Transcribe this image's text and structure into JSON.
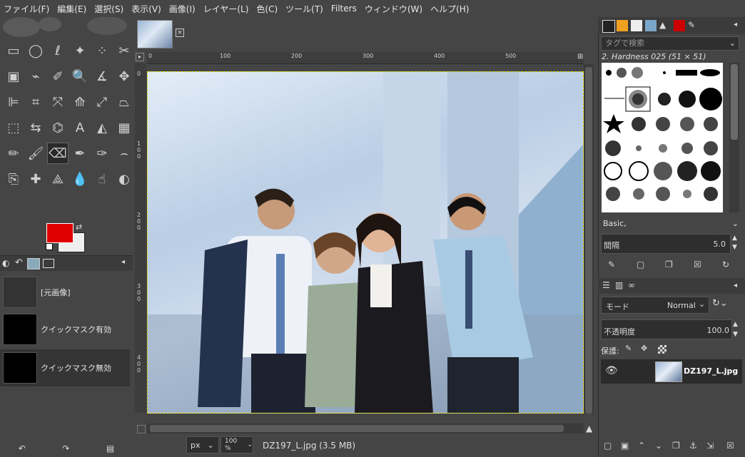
{
  "menubar": {
    "items": [
      "ファイル(F)",
      "編集(E)",
      "選択(S)",
      "表示(V)",
      "画像(I)",
      "レイヤー(L)",
      "色(C)",
      "ツール(T)",
      "Filters",
      "ウィンドウ(W)",
      "ヘルプ(H)"
    ]
  },
  "toolbox": {
    "tools": [
      "rect-select",
      "ellipse-select",
      "free-select",
      "fuzzy-select",
      "select-by-color",
      "scissors",
      "foreground-select",
      "paths",
      "color-picker",
      "zoom",
      "measure",
      "move",
      "align",
      "crop",
      "unified-transform",
      "warp-transform",
      "handle-transform",
      "perspective",
      "3d-transform",
      "flip",
      "cage-transform",
      "text",
      "bucket-fill",
      "gradient",
      "pencil",
      "paintbrush",
      "eraser",
      "airbrush",
      "ink",
      "mypaint-brush",
      "clone",
      "heal",
      "perspective-clone",
      "blur",
      "smudge",
      "dodge-burn"
    ],
    "fg_color": "#e00000",
    "bg_color": "#efefef"
  },
  "history": {
    "items": [
      "[元画像]",
      "クイックマスク有効",
      "クイックマスク無効"
    ]
  },
  "image": {
    "rulers_h": [
      "0",
      "100",
      "200",
      "300",
      "400",
      "500"
    ],
    "rulers_v": [
      "0",
      "100",
      "200",
      "300",
      "400"
    ]
  },
  "status": {
    "unit": "px",
    "zoom": "100 %",
    "file_info": "DZ197_L.jpg (3.5 MB)"
  },
  "brushes": {
    "tag_placeholder": "タグで検索",
    "selected_name": "2. Hardness 025 (51 × 51)",
    "set_name": "Basic,",
    "spacing_label": "間隔",
    "spacing_value": "5.0"
  },
  "layers": {
    "mode_label": "モード",
    "mode_value": "Normal",
    "opacity_label": "不透明度",
    "opacity_value": "100.0",
    "lock_label": "保護:",
    "layer_name": "DZ197_L.jpg"
  }
}
